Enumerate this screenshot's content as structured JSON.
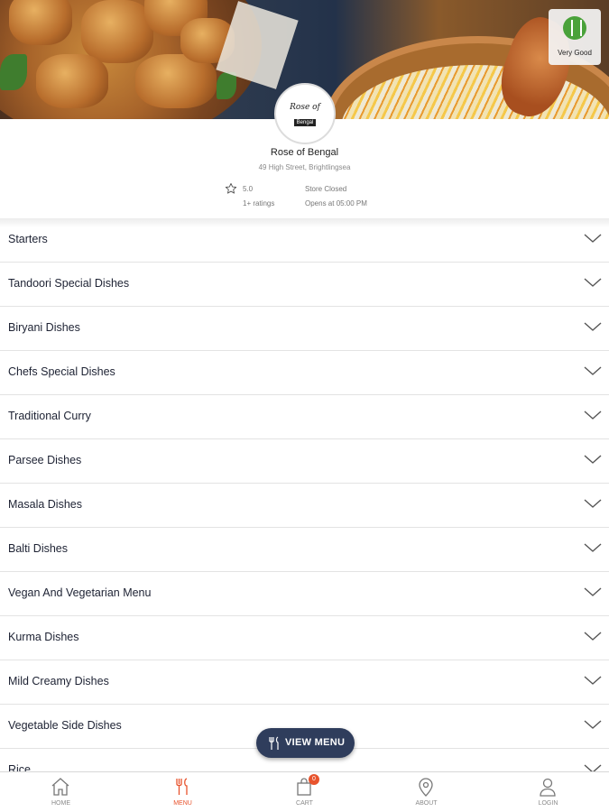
{
  "hero": {
    "hygiene_label": "Very Good"
  },
  "restaurant": {
    "name": "Rose of Bengal",
    "address": "49 High Street, Brightlingsea",
    "rating": "5.0",
    "ratings_count": "1+ ratings",
    "status": "Store Closed",
    "opens": "Opens at 05:00 PM"
  },
  "categories": [
    "Starters",
    "Tandoori Special Dishes",
    "Biryani Dishes",
    "Chefs Special Dishes",
    "Traditional Curry",
    "Parsee Dishes",
    "Masala Dishes",
    "Balti Dishes",
    "Vegan And Vegetarian Menu",
    "Kurma Dishes",
    "Mild Creamy Dishes",
    "Vegetable Side Dishes",
    "Rice"
  ],
  "view_menu_label": "VIEW MENU",
  "nav": {
    "items": [
      {
        "label": "HOME",
        "icon": "home-icon"
      },
      {
        "label": "MENU",
        "icon": "cutlery-icon"
      },
      {
        "label": "CART",
        "icon": "shopping-bag-icon"
      },
      {
        "label": "ABOUT",
        "icon": "location-pin-icon"
      },
      {
        "label": "LOGIN",
        "icon": "user-icon"
      }
    ],
    "active": "MENU",
    "cart_count": "0"
  },
  "colors": {
    "accent": "#e8532d",
    "view_menu_bg": "#2f3d5c",
    "text": "#1d2233"
  }
}
